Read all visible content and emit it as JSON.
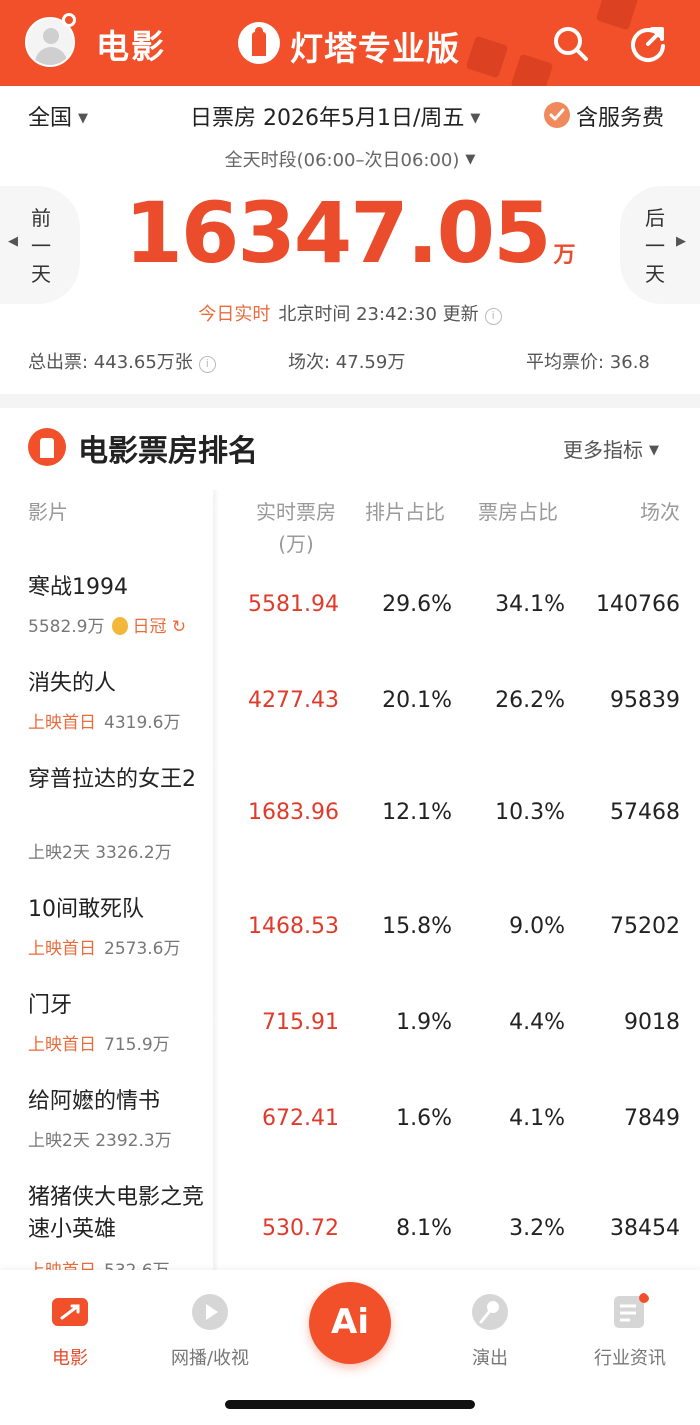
{
  "header": {
    "section": "电影",
    "brand": "灯塔专业版",
    "accent_color": "#f1502a"
  },
  "filters": {
    "region": "全国",
    "date": "日票房 2026年5月1日/周五",
    "fee_label": "含服务费",
    "fee_checked": true,
    "time_range": "全天时段(06:00–次日06:00)"
  },
  "day_nav": {
    "prev": "前一天",
    "next": "后一天"
  },
  "summary": {
    "total": "16347.05",
    "unit": "万",
    "realtime_label": "今日实时",
    "update_text": "北京时间 23:42:30 更新",
    "total_tickets": "总出票: 443.65万张",
    "shows": "场次: 47.59万",
    "avg_price": "平均票价: 36.8"
  },
  "ranking": {
    "title": "电影票房排名",
    "more_metrics": "更多指标",
    "columns": {
      "film": "影片",
      "realtime": "实时票房",
      "realtime_unit": "(万)",
      "schedule": "排片占比",
      "share": "票房占比",
      "shows": "场次"
    },
    "rows": [
      {
        "name": "寒战1994",
        "tag": "",
        "sub": "5582.9万",
        "badge": "日冠",
        "realtime": "5581.94",
        "schedule": "29.6%",
        "share": "34.1%",
        "shows": "140766"
      },
      {
        "name": "消失的人",
        "tag": "上映首日",
        "sub": "4319.6万",
        "badge": "",
        "realtime": "4277.43",
        "schedule": "20.1%",
        "share": "26.2%",
        "shows": "95839"
      },
      {
        "name": "穿普拉达的女王2",
        "tag": "",
        "sub": "上映2天 3326.2万",
        "badge": "",
        "realtime": "1683.96",
        "schedule": "12.1%",
        "share": "10.3%",
        "shows": "57468"
      },
      {
        "name": "10间敢死队",
        "tag": "上映首日",
        "sub": "2573.6万",
        "badge": "",
        "realtime": "1468.53",
        "schedule": "15.8%",
        "share": "9.0%",
        "shows": "75202"
      },
      {
        "name": "门牙",
        "tag": "上映首日",
        "sub": "715.9万",
        "badge": "",
        "realtime": "715.91",
        "schedule": "1.9%",
        "share": "4.4%",
        "shows": "9018"
      },
      {
        "name": "给阿嬷的情书",
        "tag": "",
        "sub": "上映2天 2392.3万",
        "badge": "",
        "realtime": "672.41",
        "schedule": "1.6%",
        "share": "4.1%",
        "shows": "7849"
      },
      {
        "name": "猪猪侠大电影之竞速小英雄",
        "tag": "上映首日",
        "sub": "532.6万",
        "badge": "",
        "realtime": "530.72",
        "schedule": "8.1%",
        "share": "3.2%",
        "shows": "38454"
      }
    ]
  },
  "bottom_nav": {
    "items": [
      {
        "label": "电影",
        "icon": "movie-icon",
        "active": true
      },
      {
        "label": "网播/收视",
        "icon": "play-icon",
        "active": false
      },
      {
        "label": "演出",
        "icon": "microphone-icon",
        "active": false
      },
      {
        "label": "行业资讯",
        "icon": "news-icon",
        "active": false
      }
    ],
    "ai_label": "Ai"
  }
}
